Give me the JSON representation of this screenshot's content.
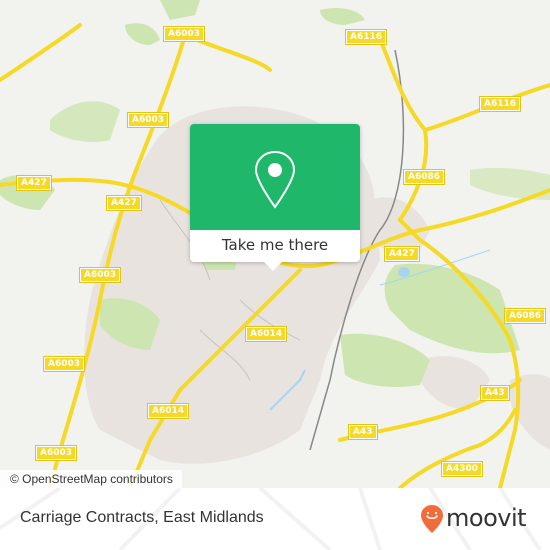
{
  "map": {
    "attribution": "© OpenStreetMap contributors",
    "road_labels": [
      {
        "id": "a6003-top",
        "text": "A6003"
      },
      {
        "id": "a6116-top",
        "text": "A6116"
      },
      {
        "id": "a6116-right",
        "text": "A6116"
      },
      {
        "id": "a6003-mid",
        "text": "A6003"
      },
      {
        "id": "a427-left",
        "text": "A427"
      },
      {
        "id": "a427-mid",
        "text": "A427"
      },
      {
        "id": "a6086-top",
        "text": "A6086"
      },
      {
        "id": "a427-right",
        "text": "A427"
      },
      {
        "id": "a6003-west",
        "text": "A6003"
      },
      {
        "id": "a6086-right",
        "text": "A6086"
      },
      {
        "id": "a6014-upper",
        "text": "A6014"
      },
      {
        "id": "a6003-lower",
        "text": "A6003"
      },
      {
        "id": "a43-right",
        "text": "A43"
      },
      {
        "id": "a6014-lower",
        "text": "A6014"
      },
      {
        "id": "a43-mid",
        "text": "A43"
      },
      {
        "id": "a6003-bottom",
        "text": "A6003"
      },
      {
        "id": "a4300",
        "text": "A4300"
      }
    ],
    "colors": {
      "background": "#f2f2ef",
      "urban": "#e8e3df",
      "park": "#cde5b0",
      "road": "#f5d924",
      "water": "#a8d4f0",
      "rail": "#888888"
    }
  },
  "popup": {
    "icon": "map-pin-icon",
    "button_label": "Take me there",
    "color": "#1fb86a"
  },
  "footer": {
    "place_name": "Carriage Contracts, East Midlands",
    "brand": "moovit",
    "brand_color": "#f26b3a"
  }
}
